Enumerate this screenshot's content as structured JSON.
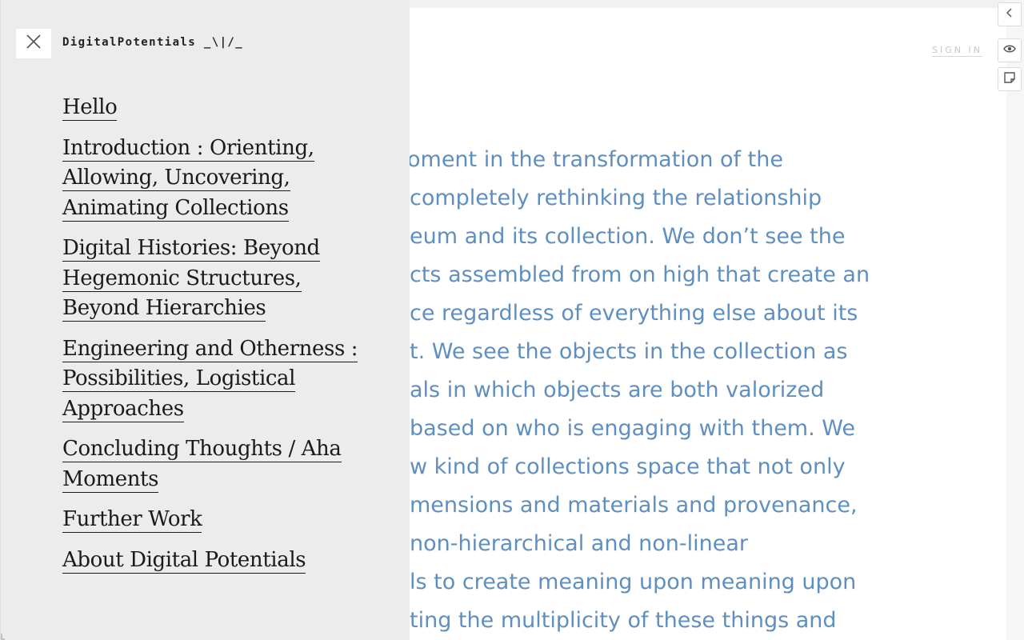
{
  "header": {
    "sign_in_label": "SIGN IN"
  },
  "article": {
    "lines": [
      "oment in the transformation of the",
      "completely rethinking the relationship",
      "eum and its collection. We don’t see the",
      "cts assembled from on high that create an",
      "ce regardless of everything else about its",
      "t. We see the objects in the collection as",
      "als in which objects are both valorized",
      "based on who is engaging with them. We",
      "w kind of collections space that not only",
      "mensions and materials and provenance,",
      "non-hierarchical and non-linear",
      "ls to create meaning upon meaning upon",
      "ting the multiplicity of these things and"
    ],
    "text_color": "#5f8fbf"
  },
  "nav": {
    "site_title": "DigitalPotentials _\\|/_",
    "close_icon": "close-icon",
    "items": [
      {
        "label": "Hello"
      },
      {
        "label": "Introduction : Orienting, Allowing, Uncovering, Animating Collections"
      },
      {
        "label": "Digital Histories: Beyond Hegemonic Structures, Beyond Hierarchies"
      },
      {
        "label": "Engineering and Otherness : Possibilities, Logistical Approaches"
      },
      {
        "label": "Concluding Thoughts / Aha Moments"
      },
      {
        "label": "Further Work"
      },
      {
        "label": "About Digital Potentials"
      }
    ]
  },
  "rail": {
    "buttons": [
      {
        "icon": "chevron-left-icon"
      },
      {
        "icon": "eye-icon"
      },
      {
        "icon": "note-icon"
      }
    ]
  }
}
